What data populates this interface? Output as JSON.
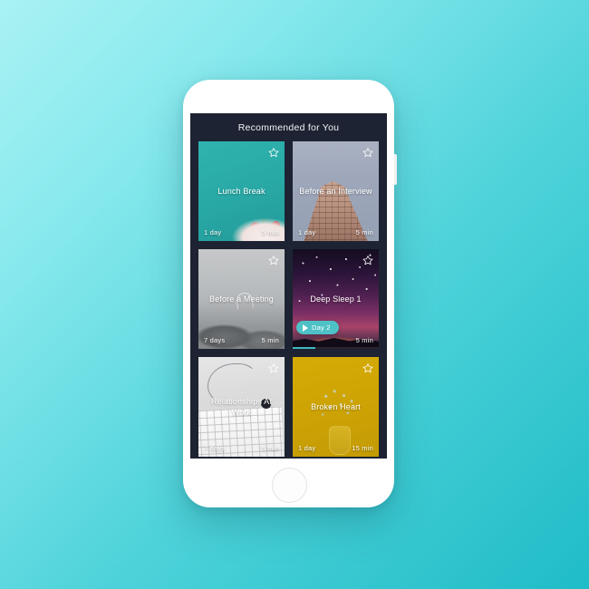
{
  "screen": {
    "title": "Recommended for You"
  },
  "cards": [
    {
      "title": "Lunch Break",
      "days": "1 day",
      "duration": "5 min",
      "favorite_icon": "star-outline-icon",
      "art": "art-lunch",
      "accent": "#28a8a5"
    },
    {
      "title": "Before an Interview",
      "days": "1 day",
      "duration": "5 min",
      "favorite_icon": "star-outline-icon",
      "art": "art-interview",
      "accent": "#9ea7ba"
    },
    {
      "title": "Before a Meeting",
      "days": "7 days",
      "duration": "5 min",
      "favorite_icon": "star-outline-icon",
      "art": "art-meeting",
      "accent": "#b3b6b8"
    },
    {
      "title": "Deep Sleep 1",
      "days": "",
      "duration": "5 min",
      "favorite_icon": "star-outline-icon",
      "art": "art-sleep",
      "accent": "#4ec1c6",
      "play_button": {
        "label": "Day 2",
        "icon": "play-triangle-icon"
      },
      "progress_percent": 26
    },
    {
      "title": "Relationships At Work",
      "days": "7 days",
      "duration": "5 min",
      "favorite_icon": "star-outline-icon",
      "art": "art-relationships",
      "accent": "#d2d2d4"
    },
    {
      "title": "Broken Heart",
      "days": "1 day",
      "duration": "15 min",
      "favorite_icon": "star-outline-icon",
      "art": "art-broken",
      "accent": "#cfa505"
    }
  ],
  "device": {
    "home_button": "home-button",
    "camera": "front-camera-icon",
    "speaker": "earpiece-speaker",
    "sensor": "proximity-sensor"
  },
  "colors": {
    "background_start": "#a9f2f3",
    "background_end": "#1fbcc7",
    "screen_background": "#1d2332",
    "accent_teal": "#4ec1c6"
  }
}
